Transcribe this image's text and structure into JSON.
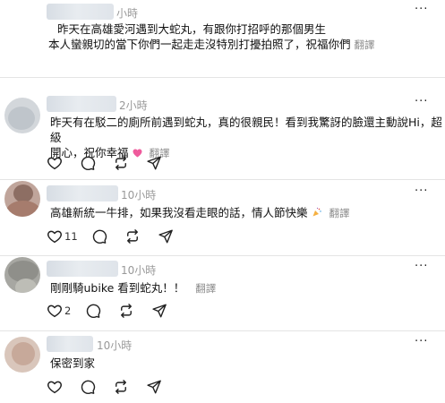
{
  "comments": [
    {
      "time": "小時",
      "lines": [
        "昨天在高雄愛河遇到大蛇丸，有跟你打招呼的那個男生",
        "本人蠻親切的當下你們一起走走沒特別打擾拍照了，祝福你們"
      ],
      "translate": "翻譯",
      "like_count": ""
    },
    {
      "time": "2小時",
      "lines": [
        "昨天有在駁二的廁所前遇到蛇丸，真的很親民！看到我驚訝的臉還主動說Hi，超級",
        "開心，祝你幸福"
      ],
      "translate": "翻譯",
      "like_count": ""
    },
    {
      "time": "10小時",
      "lines": [
        "高雄新統一牛排，如果我沒看走眼的話，情人節快樂"
      ],
      "translate": "翻譯",
      "like_count": "11"
    },
    {
      "time": "10小時",
      "lines": [
        "剛剛騎ubike 看到蛇丸！！"
      ],
      "translate": "翻譯",
      "like_count": "2"
    },
    {
      "time": "10小時",
      "lines": [
        "保密到家"
      ],
      "translate": "",
      "like_count": ""
    }
  ],
  "icons": {
    "like": "heart-icon",
    "reply": "comment-bubble-icon",
    "repost": "repost-icon",
    "share": "send-icon",
    "more": "more-horizontal-icon"
  },
  "colors": {
    "text": "#111111",
    "muted": "#999999",
    "divider": "#e4e4e4",
    "heart_emoji": "#ef5b9c"
  }
}
